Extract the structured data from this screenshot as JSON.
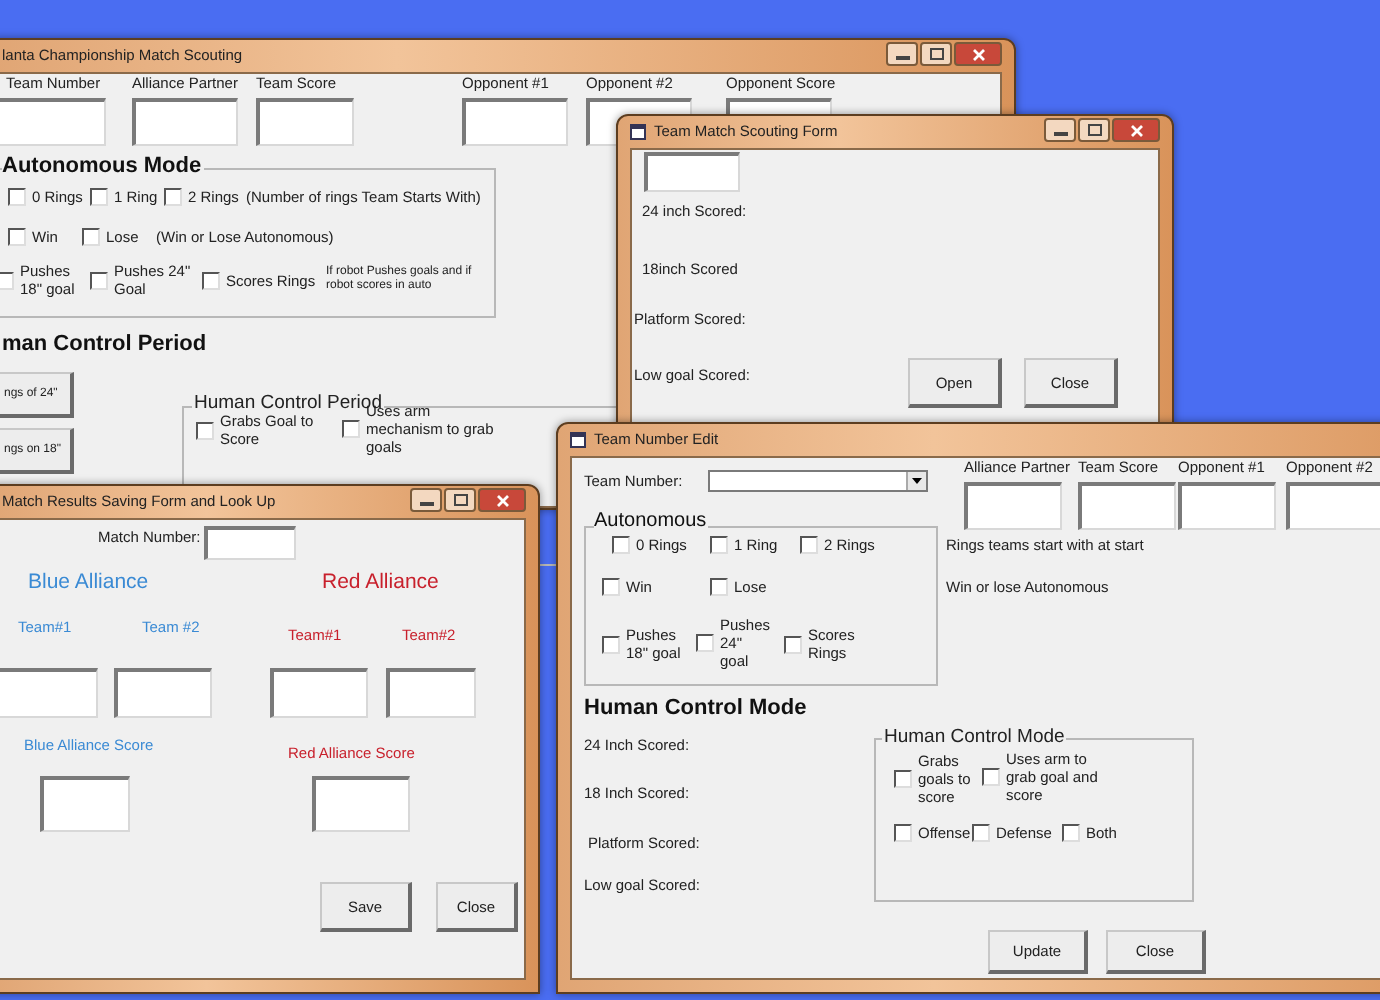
{
  "main_window": {
    "title": "lanta Championship Match Scouting",
    "field_labels": [
      "Team Number",
      "Alliance Partner",
      "Team Score",
      "Opponent #1",
      "Opponent #2",
      "Opponent Score"
    ],
    "autonomous_group": {
      "title": "Autonomous Mode",
      "checkboxes": [
        {
          "label": "0 Rings",
          "checked": false
        },
        {
          "label": "1 Ring",
          "checked": false
        },
        {
          "label": "2 Rings",
          "checked": false
        },
        {
          "label": "Win",
          "checked": false
        },
        {
          "label": "Lose",
          "checked": false
        },
        {
          "label": "Pushes 18\" goal",
          "checked": false
        },
        {
          "label": "Pushes 24\" Goal",
          "checked": false
        },
        {
          "label": "Scores Rings",
          "checked": false
        }
      ],
      "notes": [
        "(Number of rings Team Starts With)",
        "(Win or Lose Autonomous)",
        "If robot Pushes goals and if robot scores in auto"
      ]
    },
    "section_heading": "man Control Period",
    "side_buttons": [
      "ngs of 24\"",
      "ngs on 18\""
    ],
    "human_group": {
      "title": "Human Control Period",
      "checkboxes": [
        {
          "label": "Grabs Goal to Score",
          "checked": false
        },
        {
          "label": "Uses arm mechanism to grab goals",
          "checked": false
        }
      ]
    }
  },
  "scouting_form": {
    "title": "Team Match Scouting Form",
    "score_labels": [
      "24 inch Scored:",
      "18inch Scored",
      "Platform Scored:",
      "Low goal Scored:"
    ],
    "buttons": [
      "Open",
      "Close"
    ]
  },
  "team_edit": {
    "title": "Team Number Edit",
    "team_number_label": "Team Number:",
    "field_labels": [
      "Alliance Partner",
      "Team Score",
      "Opponent #1",
      "Opponent #2"
    ],
    "autonomous_group": {
      "title": "Autonomous",
      "checkboxes": [
        {
          "label": "0 Rings",
          "checked": false
        },
        {
          "label": "1 Ring",
          "checked": false
        },
        {
          "label": "2 Rings",
          "checked": false
        },
        {
          "label": "Win",
          "checked": false
        },
        {
          "label": "Lose",
          "checked": false
        },
        {
          "label": "Pushes 18\" goal",
          "checked": false
        },
        {
          "label": "Pushes 24\" goal",
          "checked": false
        },
        {
          "label": "Scores Rings",
          "checked": false
        }
      ]
    },
    "notes": [
      "Rings teams start with at start",
      "Win or lose Autonomous"
    ],
    "section_heading": "Human Control Mode",
    "score_labels": [
      "24 Inch Scored:",
      "18 Inch Scored:",
      "Platform Scored:",
      "Low goal Scored:"
    ],
    "human_group": {
      "title": "Human Control Mode",
      "checkboxes": [
        {
          "label": "Grabs goals to score",
          "checked": false
        },
        {
          "label": "Uses arm to grab goal and score",
          "checked": false
        },
        {
          "label": "Offense",
          "checked": false
        },
        {
          "label": "Defense",
          "checked": false
        },
        {
          "label": "Both",
          "checked": false
        }
      ]
    },
    "buttons": [
      "Update",
      "Close"
    ]
  },
  "results_form": {
    "title": "Match Results Saving Form and Look Up",
    "match_number_label": "Match Number:",
    "alliances": [
      {
        "name": "Blue Alliance",
        "color": "#3a8ad4",
        "team_labels": [
          "Team#1",
          "Team #2"
        ],
        "score_label": "Blue Alliance Score"
      },
      {
        "name": "Red Alliance",
        "color": "#c8202c",
        "team_labels": [
          "Team#1",
          "Team#2"
        ],
        "score_label": "Red Alliance Score"
      }
    ],
    "buttons": [
      "Save",
      "Close"
    ]
  }
}
